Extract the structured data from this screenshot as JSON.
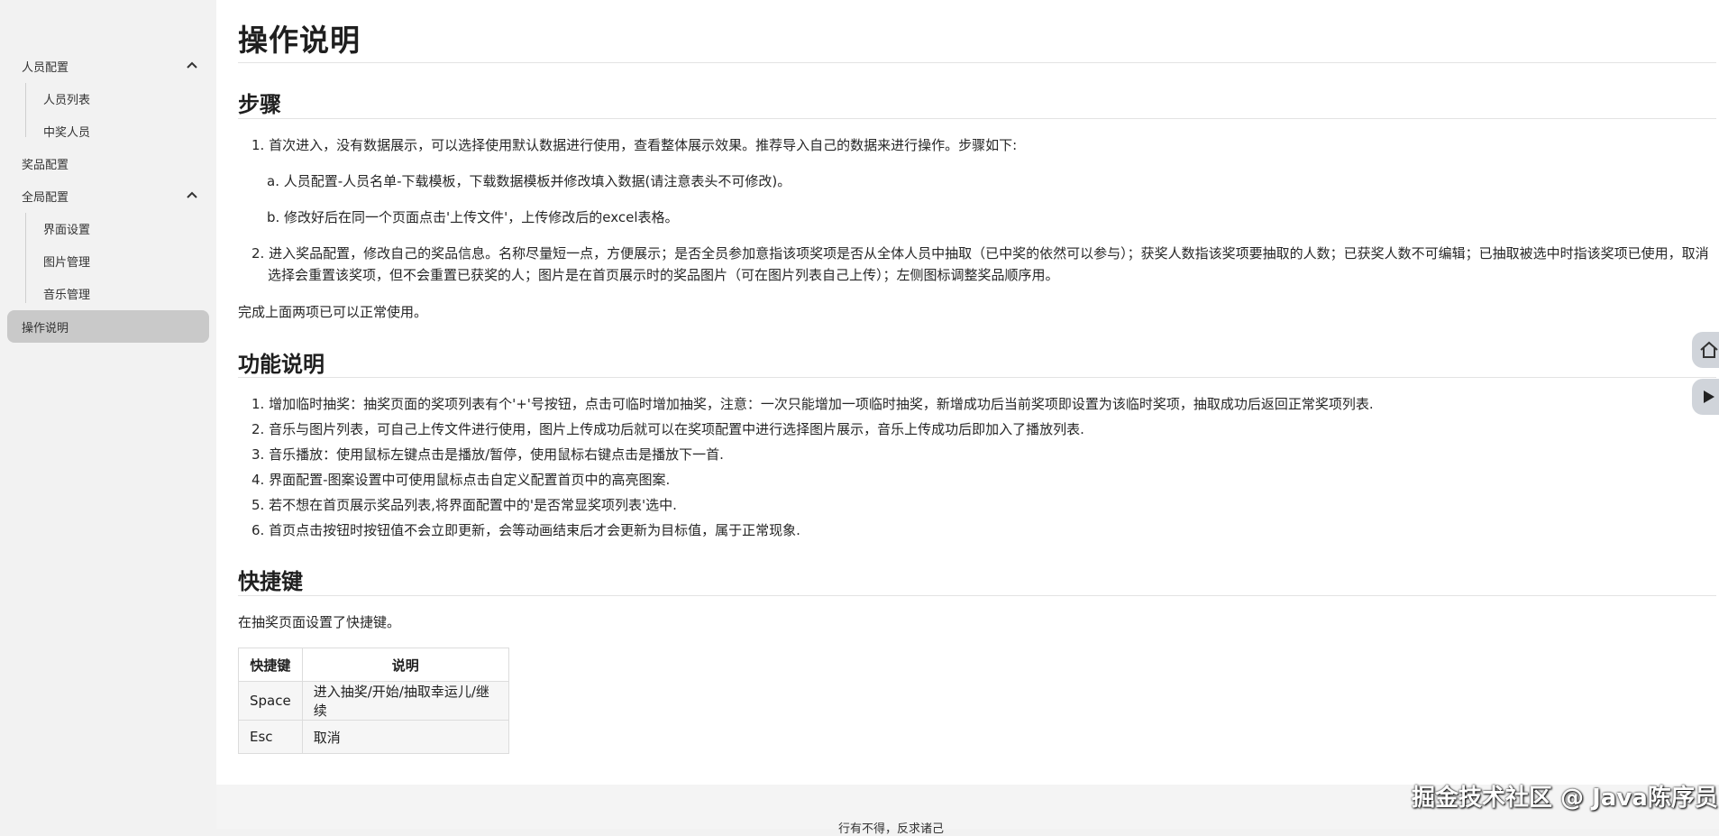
{
  "sidebar": {
    "groups": [
      {
        "label": "人员配置",
        "items": [
          "人员列表",
          "中奖人员"
        ]
      },
      {
        "label": "奖品配置"
      },
      {
        "label": "全局配置",
        "items": [
          "界面设置",
          "图片管理",
          "音乐管理"
        ]
      },
      {
        "label": "操作说明",
        "active": true
      }
    ]
  },
  "page": {
    "title": "操作说明",
    "steps": {
      "heading": "步骤",
      "item1": "1. 首次进入，没有数据展示，可以选择使用默认数据进行使用，查看整体展示效果。推荐导入自己的数据来进行操作。步骤如下:",
      "sub_a": "a. 人员配置-人员名单-下载模板，下载数据模板并修改填入数据(请注意表头不可修改)。",
      "sub_b": "b. 修改好后在同一个页面点击'上传文件'，上传修改后的excel表格。",
      "item2": "2. 进入奖品配置，修改自己的奖品信息。名称尽量短一点，方便展示；是否全员参加意指该项奖项是否从全体人员中抽取（已中奖的依然可以参与）；获奖人数指该奖项要抽取的人数；已获奖人数不可编辑；已抽取被选中时指该奖项已使用，取消选择会重置该奖项，但不会重置已获奖的人；图片是在首页展示时的奖品图片（可在图片列表自己上传）；左侧图标调整奖品顺序用。",
      "done": "完成上面两项已可以正常使用。"
    },
    "features": {
      "heading": "功能说明",
      "items": [
        "1. 增加临时抽奖：抽奖页面的奖项列表有个'+'号按钮，点击可临时增加抽奖，注意：一次只能增加一项临时抽奖，新增成功后当前奖项即设置为该临时奖项，抽取成功后返回正常奖项列表.",
        "2. 音乐与图片列表，可自己上传文件进行使用，图片上传成功后就可以在奖项配置中进行选择图片展示，音乐上传成功后即加入了播放列表.",
        "3. 音乐播放：使用鼠标左键点击是播放/暂停，使用鼠标右键点击是播放下一首.",
        "4. 界面配置-图案设置中可使用鼠标点击自定义配置首页中的高亮图案.",
        "5. 若不想在首页展示奖品列表,将界面配置中的'是否常显奖项列表'选中.",
        "6. 首页点击按钮时按钮值不会立即更新，会等动画结束后才会更新为目标值，属于正常现象."
      ]
    },
    "shortcuts": {
      "heading": "快捷键",
      "intro": "在抽奖页面设置了快捷键。",
      "headers": [
        "快捷键",
        "说明"
      ],
      "rows": [
        [
          "Space",
          "进入抽奖/开始/抽取幸运儿/继续"
        ],
        [
          "Esc",
          "取消"
        ]
      ]
    }
  },
  "footer": {
    "text": "行有不得，反求诸己"
  },
  "watermark": "掘金技术社区 @ Java陈序员",
  "icons": [
    "chevron-up-icon",
    "home-icon",
    "play-icon"
  ]
}
